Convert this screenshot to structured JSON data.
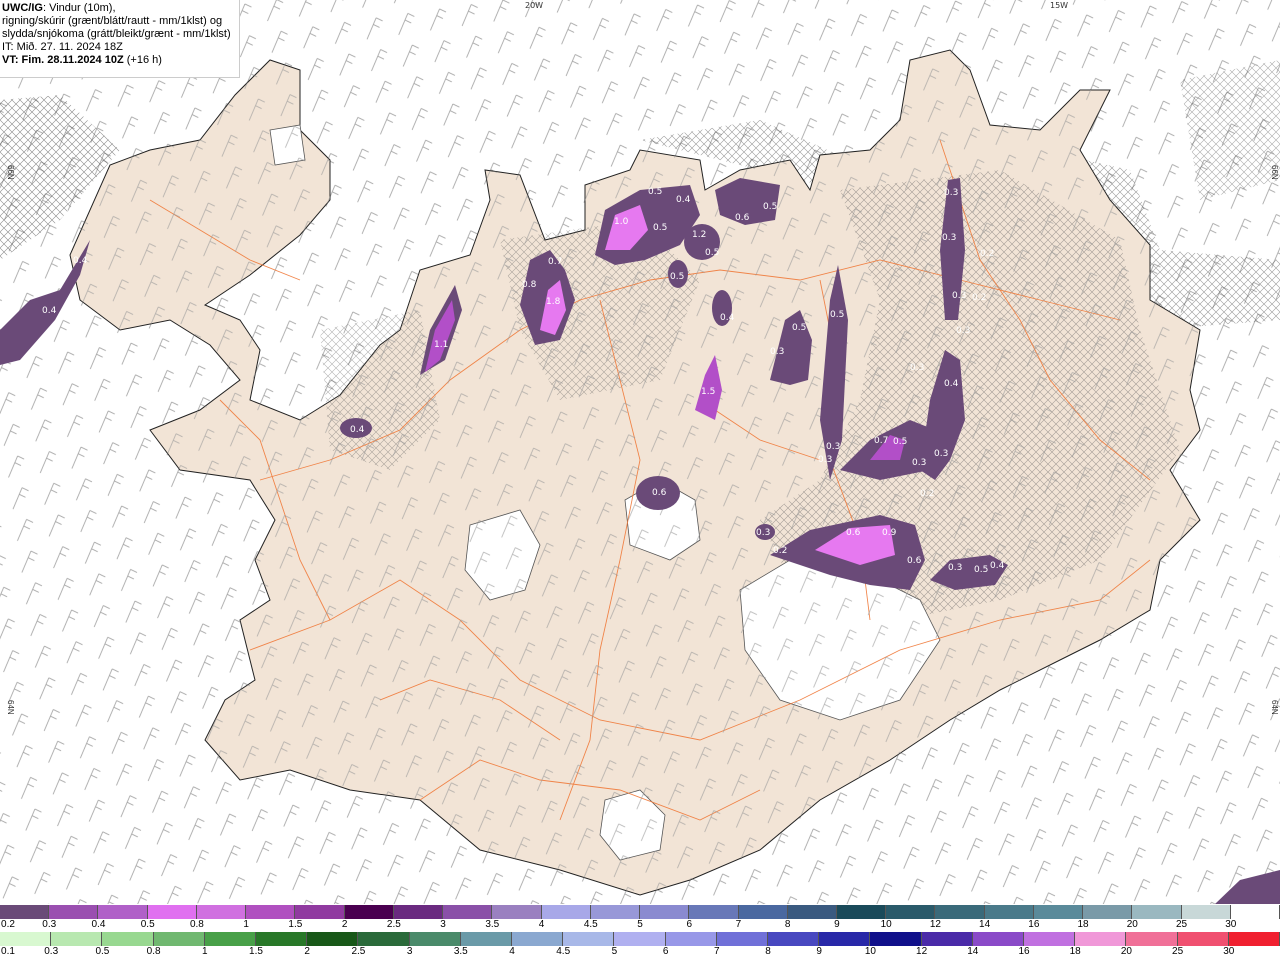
{
  "header": {
    "line1_bold": "UWC/IG",
    "line1_rest": ": Vindur (10m),",
    "line2": "rigning/skúrir (grænt/blátt/rautt - mm/1klst) og",
    "line3": "slydda/snjókoma (grátt/bleikt/grænt - mm/1klst)",
    "line4": "IT: Mið. 27. 11. 2024 18Z",
    "line5_bold": "VT: Fim. 28.11.2024 10Z",
    "line5_rest": " (+16 h)"
  },
  "grid_labels": {
    "lon_20w": "20W",
    "lon_15w": "15W",
    "lat_left_top": "66N",
    "lat_right_top": "66N",
    "lat_left_bottom": "64N",
    "lat_right_bottom": "64N"
  },
  "precip_labels": [
    "0.4",
    "0.4",
    "1.1",
    "0.4",
    "0.7",
    "0.8",
    "1.8",
    "0.5",
    "0.4",
    "1.0",
    "0.5",
    "0.6",
    "0.5",
    "1.2",
    "0.5",
    "0.5",
    "0.4",
    "1.5",
    "0.6",
    "0.5",
    "0.3",
    "0.5",
    "0.3",
    "0.3",
    "0.2",
    "0.3",
    "0.3",
    "0.2",
    "0.4",
    "0.3",
    "0.3",
    "0.7",
    "0.5",
    "0.3",
    "0.3",
    "0.3",
    "0.2",
    "0.6",
    "0.9",
    "0.6",
    "0.3",
    "0.5",
    "0.4",
    "0.3",
    "0.2"
  ],
  "colors": {
    "land": "#f2e4d6",
    "sea": "#ffffff",
    "roads": "#f07a3a",
    "snow_light": "#6a4a78",
    "snow_mid": "#b24fc8",
    "snow_strong": "#e679f0"
  },
  "snow_scale": {
    "ticks": [
      "0.2",
      "0.3",
      "0.4",
      "0.5",
      "0.8",
      "1",
      "1.5",
      "2",
      "2.5",
      "3",
      "3.5",
      "4",
      "4.5",
      "5",
      "6",
      "7",
      "8",
      "9",
      "10",
      "12",
      "14",
      "16",
      "18",
      "20",
      "25",
      "30"
    ],
    "colors": [
      "#6a4a78",
      "#9a4fb0",
      "#b060c8",
      "#e070f0",
      "#d070e0",
      "#b050c0",
      "#903aa0",
      "#4a0050",
      "#6a2a80",
      "#8a50a8",
      "#9a80c0",
      "#a8a8e8",
      "#9898d8",
      "#8a8ad0",
      "#6878b8",
      "#4a68a0",
      "#3a5a80",
      "#1a4a5a",
      "#2a5a6a",
      "#3a6a7a",
      "#4a7a8a",
      "#5a8a9a",
      "#7a9aa8",
      "#9ab8c0",
      "#c8d8d8",
      "#ffffff"
    ]
  },
  "rain_scale": {
    "ticks": [
      "0.1",
      "0.3",
      "0.5",
      "0.8",
      "1",
      "1.5",
      "2",
      "2.5",
      "3",
      "3.5",
      "4",
      "4.5",
      "5",
      "6",
      "7",
      "8",
      "9",
      "10",
      "12",
      "14",
      "16",
      "18",
      "20",
      "25",
      "30"
    ],
    "colors": [
      "#d8f8d0",
      "#b8e8b0",
      "#98d890",
      "#70b870",
      "#48a048",
      "#287828",
      "#185818",
      "#2a6a3a",
      "#4a8a6a",
      "#6a9aa8",
      "#8aa8d0",
      "#a8b8e8",
      "#b0b0f0",
      "#9898e8",
      "#7070d8",
      "#4848c0",
      "#2828a8",
      "#10108a",
      "#4a2aa8",
      "#8a4ac8",
      "#c070e0",
      "#f098d8",
      "#f07098",
      "#f05070",
      "#f02030"
    ]
  }
}
